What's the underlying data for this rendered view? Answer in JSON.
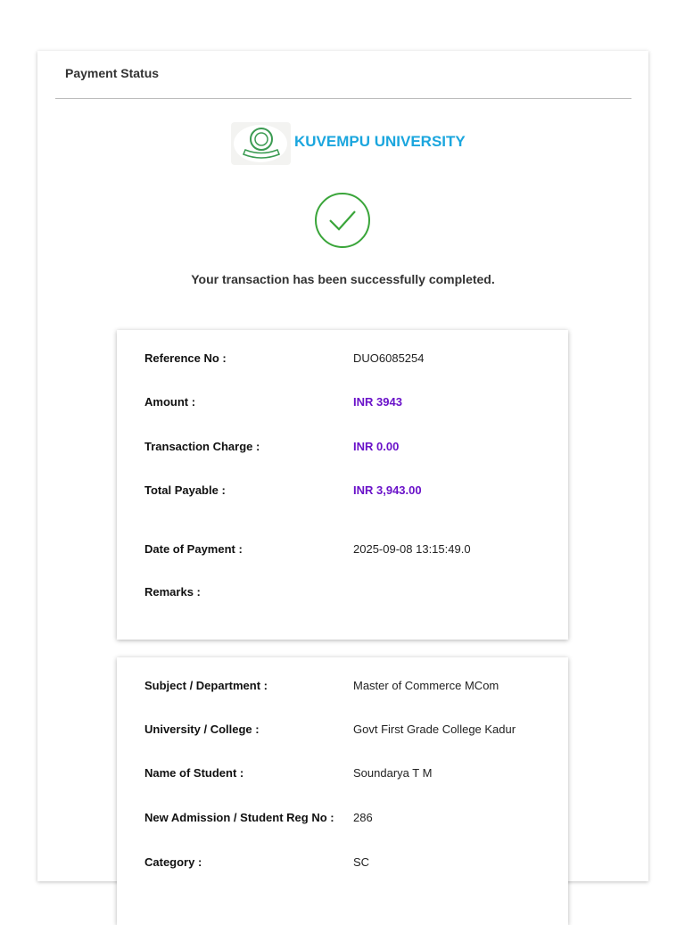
{
  "header": {
    "title": "Payment Status"
  },
  "brand": {
    "name": "KUVEMPU UNIVERSITY",
    "color": "#1ba6de",
    "logo_icon": "university-seal"
  },
  "status": {
    "icon": "check-circle-icon",
    "message": "Your transaction has been successfully completed."
  },
  "payment": [
    {
      "label": "Reference No :",
      "value": "DUO6085254"
    },
    {
      "label": "Amount :",
      "value": "INR 3943"
    },
    {
      "label": "Transaction Charge :",
      "value": "INR 0.00"
    },
    {
      "label": "Total Payable :",
      "value": "INR 3,943.00"
    },
    {
      "label": "Date of Payment :",
      "value": "2025-09-08 13:15:49.0"
    },
    {
      "label": "Remarks :",
      "value": ""
    }
  ],
  "student": [
    {
      "label": "Subject / Department :",
      "value": "Master of Commerce MCom"
    },
    {
      "label": "University / College :",
      "value": "Govt First Grade College Kadur"
    },
    {
      "label": "Name of Student :",
      "value": "Soundarya T M"
    },
    {
      "label": "New Admission / Student Reg No :",
      "value": "286"
    },
    {
      "label": "Category :",
      "value": "SC"
    }
  ],
  "colors": {
    "amount": "#6a12c9",
    "success": "#3aa53a"
  }
}
